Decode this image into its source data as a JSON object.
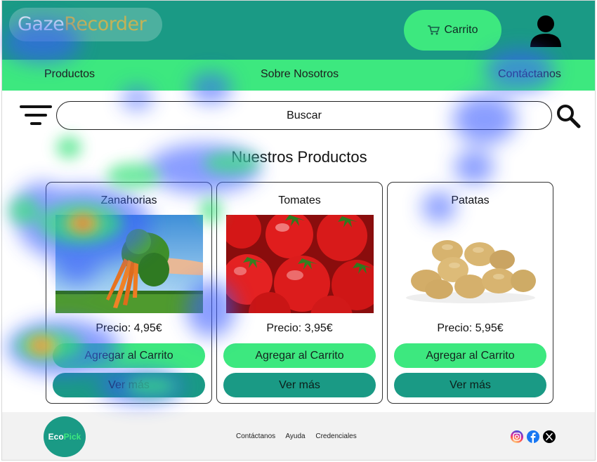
{
  "watermark": {
    "part1": "Gaze",
    "part2": "Recorder"
  },
  "header": {
    "cart_label": "Carrito",
    "cart_icon": "shopping-cart-icon",
    "user_icon": "user-icon"
  },
  "nav": {
    "items": [
      {
        "label": "Productos"
      },
      {
        "label": "Sobre Nosotros"
      },
      {
        "label": "Contáctanos"
      }
    ]
  },
  "search": {
    "value": "Buscar",
    "filter_icon": "filter-icon",
    "search_icon": "search-icon"
  },
  "section_title": "Nuestros Productos",
  "products": [
    {
      "name": "Zanahorias",
      "price": "Precio: 4,95€",
      "add_label": "Agregar al Carrito",
      "more_label": "Ver más"
    },
    {
      "name": "Tomates",
      "price": "Precio: 3,95€",
      "add_label": "Agregar al Carrito",
      "more_label": "Ver más"
    },
    {
      "name": "Patatas",
      "price": "Precio: 5,95€",
      "add_label": "Agregar al Carrito",
      "more_label": "Ver más"
    }
  ],
  "footer": {
    "logo": {
      "part1": "Eco",
      "part2": "Pick"
    },
    "links": [
      "Contáctanos",
      "Ayuda",
      "Credenciales"
    ],
    "social": [
      "instagram-icon",
      "facebook-icon",
      "x-icon"
    ]
  },
  "colors": {
    "teal": "#1a9a85",
    "green": "#3de87f",
    "footer_bg": "#f2f2f2"
  }
}
